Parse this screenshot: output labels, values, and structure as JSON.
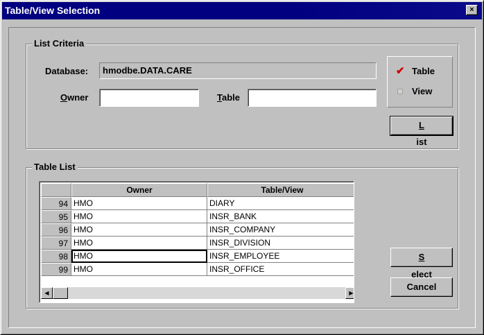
{
  "window": {
    "title": "Table/View Selection",
    "close_glyph": "×"
  },
  "criteria": {
    "legend": "List Criteria",
    "database_label": "Database:",
    "database_value": "hmodbe.DATA.CARE",
    "owner_label_u": "O",
    "owner_label_rest": "wner",
    "owner_value": "",
    "table_label_u": "T",
    "table_label_rest": "able",
    "table_value": ""
  },
  "type_options": {
    "table_label": "Table",
    "table_checked": true,
    "view_label": "View",
    "view_checked": false,
    "check_glyph": "✔"
  },
  "buttons": {
    "list_u": "L",
    "list_rest": "ist",
    "select_u": "S",
    "select_rest": "elect",
    "cancel_label": "Cancel"
  },
  "table_list": {
    "legend": "Table List",
    "columns": [
      "Owner",
      "Table/View"
    ],
    "rows": [
      {
        "num": "94",
        "owner": "HMO",
        "table": "DIARY"
      },
      {
        "num": "95",
        "owner": "HMO",
        "table": "INSR_BANK"
      },
      {
        "num": "96",
        "owner": "HMO",
        "table": "INSR_COMPANY"
      },
      {
        "num": "97",
        "owner": "HMO",
        "table": "INSR_DIVISION"
      },
      {
        "num": "98",
        "owner": "HMO",
        "table": "INSR_EMPLOYEE"
      },
      {
        "num": "99",
        "owner": "HMO",
        "table": "INSR_OFFICE"
      }
    ]
  },
  "icons": {
    "scroll_up": "▲",
    "scroll_down": "▼",
    "scroll_left": "◀",
    "scroll_right": "▶"
  }
}
